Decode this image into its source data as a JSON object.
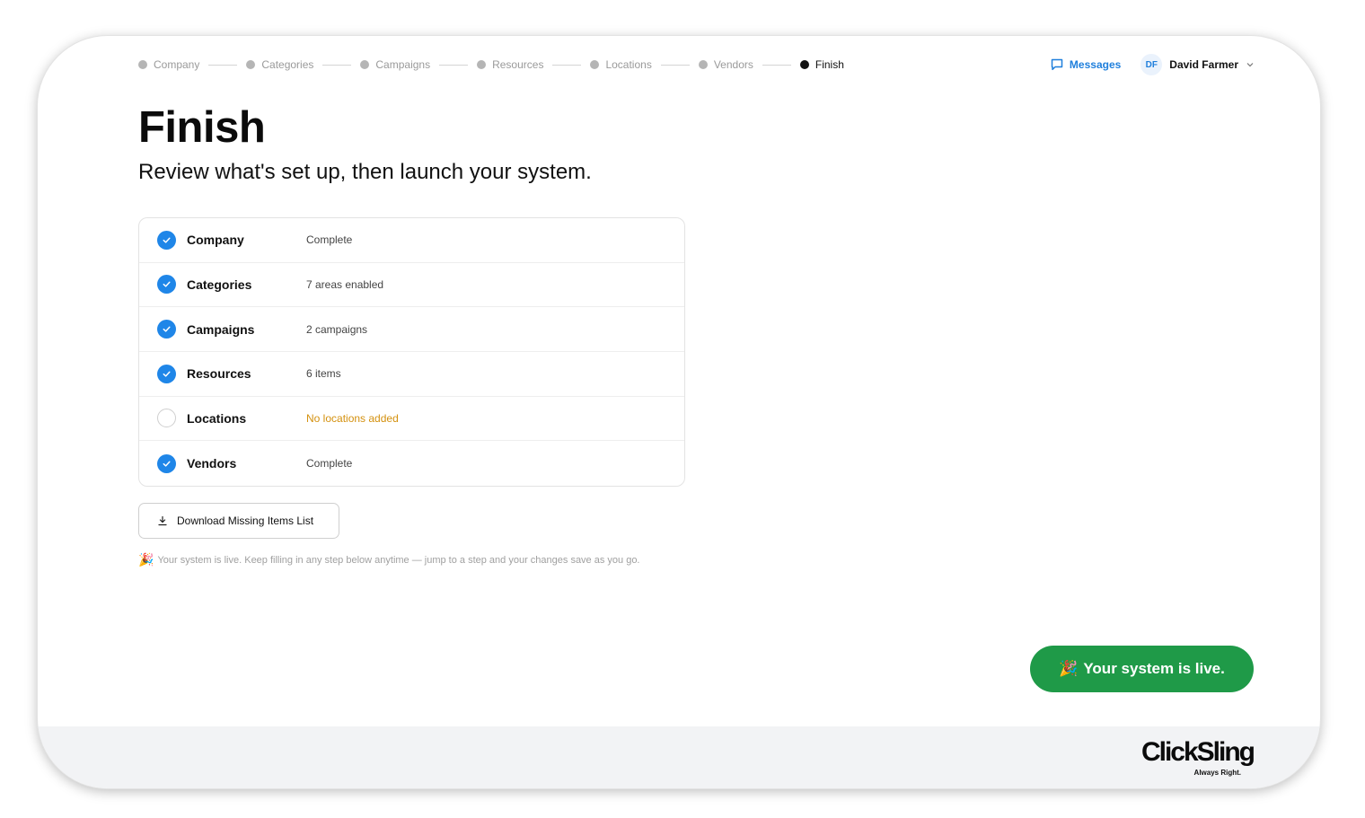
{
  "stepper": {
    "steps": [
      {
        "label": "Company",
        "active": false
      },
      {
        "label": "Categories",
        "active": false
      },
      {
        "label": "Campaigns",
        "active": false
      },
      {
        "label": "Resources",
        "active": false
      },
      {
        "label": "Locations",
        "active": false
      },
      {
        "label": "Vendors",
        "active": false
      },
      {
        "label": "Finish",
        "active": true
      }
    ]
  },
  "header": {
    "messages_label": "Messages",
    "user_initials": "DF",
    "user_name": "David Farmer"
  },
  "page": {
    "title": "Finish",
    "subtitle": "Review what's set up, then launch your system."
  },
  "summary": {
    "rows": [
      {
        "label": "Company",
        "status": "Complete",
        "complete": true
      },
      {
        "label": "Categories",
        "status": "7 areas enabled",
        "complete": true
      },
      {
        "label": "Campaigns",
        "status": "2 campaigns",
        "complete": true
      },
      {
        "label": "Resources",
        "status": "6 items",
        "complete": true
      },
      {
        "label": "Locations",
        "status": "No locations added",
        "complete": false
      },
      {
        "label": "Vendors",
        "status": "Complete",
        "complete": true
      }
    ]
  },
  "download_button": {
    "label": "Download Missing Items List"
  },
  "note": {
    "emoji": "🎉",
    "text": "Your system is live. Keep filling in any step below anytime — jump to a step and your changes save as you go."
  },
  "live_button": {
    "emoji": "🎉",
    "label": "Your system is live."
  },
  "footer": {
    "logo_text": "ClickSling",
    "tagline": "Always Right."
  },
  "colors": {
    "accent": "#1f86e8",
    "link": "#1f7fdc",
    "success": "#1f9a48",
    "warning": "#d4910f"
  }
}
